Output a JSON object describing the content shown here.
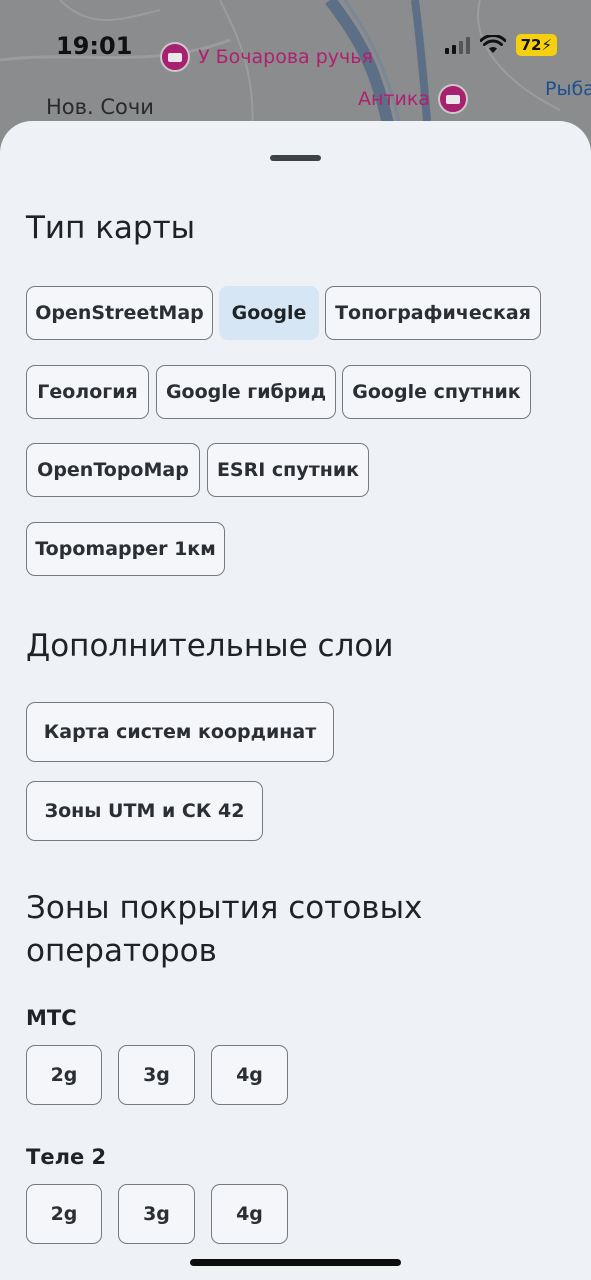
{
  "status": {
    "time": "19:01",
    "battery": "72"
  },
  "map": {
    "labels": {
      "poi1": "У Бочарова ручья",
      "poi2": "Антика",
      "district": "Нов. Сочи",
      "edge": "Рыба"
    }
  },
  "sections": {
    "map_type": {
      "title": "Тип карты",
      "options": [
        "OpenStreetMap",
        "Google",
        "Топографическая",
        "Геология",
        "Google гибрид",
        "Google спутник",
        "OpenTopoMap",
        "ESRI спутник",
        "Topomapper 1км"
      ],
      "selected": "Google"
    },
    "extra_layers": {
      "title": "Дополнительные слои",
      "options": [
        "Карта систем координат",
        "Зоны UTM и СК 42"
      ]
    },
    "coverage": {
      "title_line1": "Зоны покрытия сотовых",
      "title_line2": "операторов",
      "operators": [
        {
          "name": "МТС",
          "options": [
            "2g",
            "3g",
            "4g"
          ]
        },
        {
          "name": "Теле 2",
          "options": [
            "2g",
            "3g",
            "4g"
          ]
        }
      ]
    }
  }
}
